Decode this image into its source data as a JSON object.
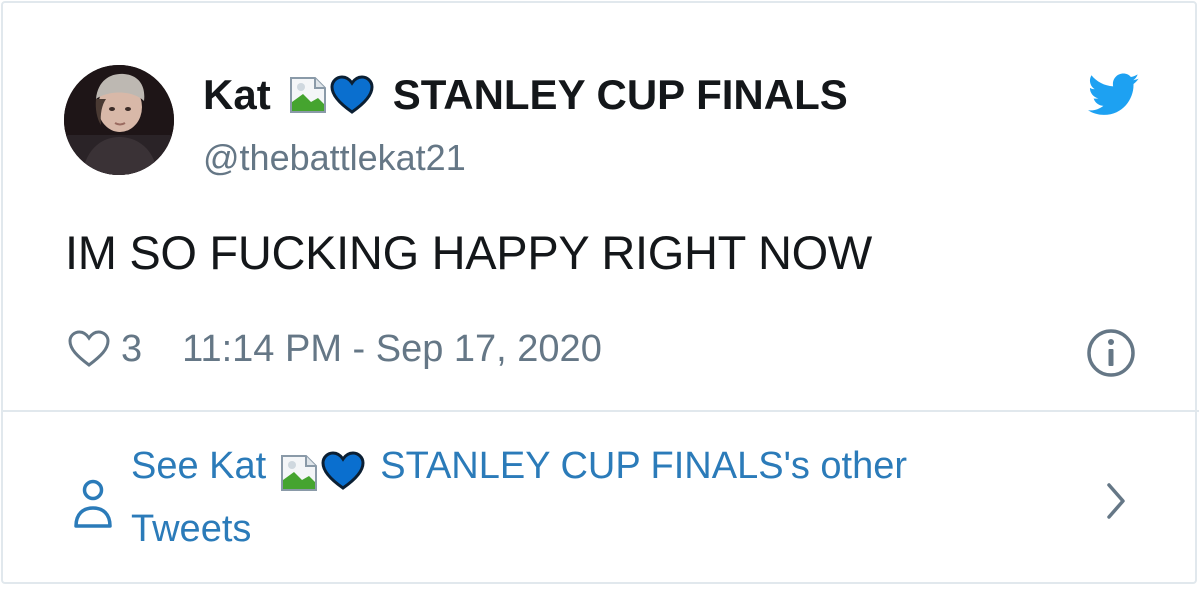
{
  "tweet": {
    "author": {
      "name_prefix": "Kat",
      "name_suffix": "STANLEY CUP FINALS",
      "handle": "@thebattlekat21",
      "avatar_icon": "profile-photo",
      "name_emojis": [
        "broken-image-icon",
        "blue-heart-icon"
      ]
    },
    "text": "IM SO FUCKING HAPPY RIGHT NOW",
    "likes": "3",
    "timestamp": "11:14 PM - Sep 17, 2020",
    "brand_color": "#1da1f2",
    "link_color": "#2b7bb9",
    "heart_color": "#0a6fcf"
  },
  "footer": {
    "prefix": "See Kat",
    "suffix": "STANLEY CUP FINALS's other",
    "line2": "Tweets"
  }
}
